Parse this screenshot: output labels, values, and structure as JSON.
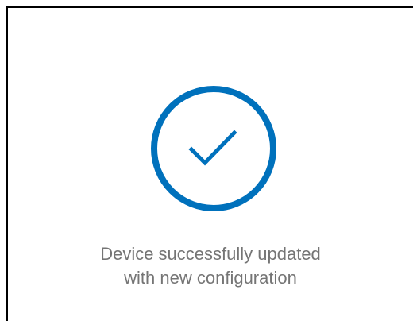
{
  "status": {
    "icon": "checkmark-circle-icon",
    "accent_color": "#0071BC",
    "message_line_1": "Device successfully updated",
    "message_line_2": "with new configuration"
  }
}
